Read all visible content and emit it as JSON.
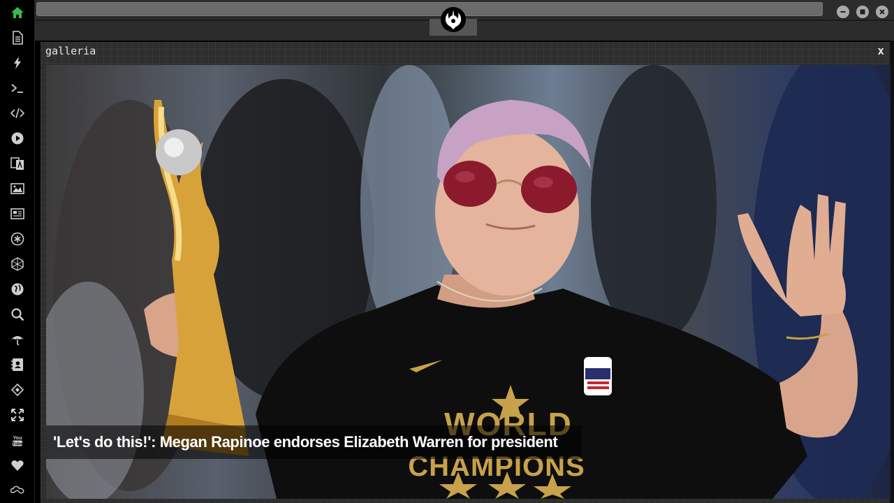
{
  "sidebar": {
    "items": [
      {
        "icon": "home-icon",
        "active": true
      },
      {
        "icon": "document-icon"
      },
      {
        "icon": "lightning-icon"
      },
      {
        "icon": "terminal-icon"
      },
      {
        "icon": "code-icon"
      },
      {
        "icon": "play-icon"
      },
      {
        "icon": "translate-icon"
      },
      {
        "icon": "image-icon"
      },
      {
        "icon": "news-icon"
      },
      {
        "icon": "asterisk-icon"
      },
      {
        "icon": "hexagon-icon"
      },
      {
        "icon": "globe-icon"
      },
      {
        "icon": "search-icon"
      },
      {
        "icon": "umbrella-icon"
      },
      {
        "icon": "contact-card-icon"
      },
      {
        "icon": "code-diamond-icon"
      },
      {
        "icon": "expand-icon"
      },
      {
        "icon": "youtube-icon"
      },
      {
        "icon": "heart-icon"
      },
      {
        "icon": "infinity-cloud-icon"
      }
    ],
    "active_color": "#3cb54a",
    "icon_color": "#cfcfcf"
  },
  "window": {
    "controls": [
      "minimize-icon",
      "maximize-icon",
      "close-icon"
    ]
  },
  "panel": {
    "title": "galleria",
    "close_label": "x"
  },
  "gallery": {
    "caption": "'Let's do this!': Megan Rapinoe endorses Elizabeth Warren for president",
    "shirt_text_line1": "WORLD",
    "shirt_text_line2": "CHAMPIONS"
  }
}
